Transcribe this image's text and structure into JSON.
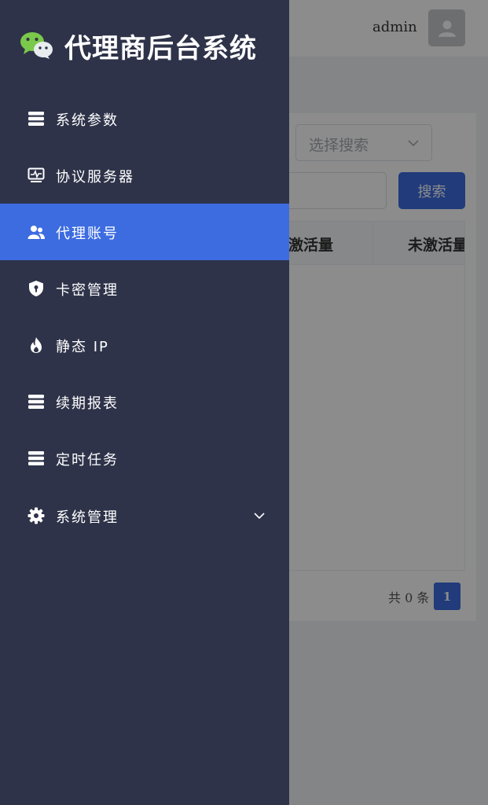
{
  "header": {
    "username": "admin",
    "avatar_icon": "user-icon"
  },
  "content": {
    "select_placeholder": "选择搜索",
    "search_button": "搜索",
    "table_columns": [
      "激活量",
      "未激活量"
    ],
    "pagination_total": "共 0 条",
    "current_page": "1"
  },
  "sidebar": {
    "title": "代理商后台系统",
    "logo_icon": "wechat-icon",
    "items": [
      {
        "label": "系统参数",
        "icon": "list-icon"
      },
      {
        "label": "协议服务器",
        "icon": "monitor-pulse-icon"
      },
      {
        "label": "代理账号",
        "icon": "users-icon",
        "active": true
      },
      {
        "label": "卡密管理",
        "icon": "shield-icon"
      },
      {
        "label": "静态 IP",
        "icon": "fire-icon"
      },
      {
        "label": "续期报表",
        "icon": "list-icon"
      },
      {
        "label": "定时任务",
        "icon": "list-icon"
      },
      {
        "label": "系统管理",
        "icon": "gear-icon",
        "expandable": true
      }
    ]
  },
  "colors": {
    "sidebar_bg": "#2e3349",
    "active_item": "#3d6ce0",
    "primary": "#3d6ce0"
  }
}
